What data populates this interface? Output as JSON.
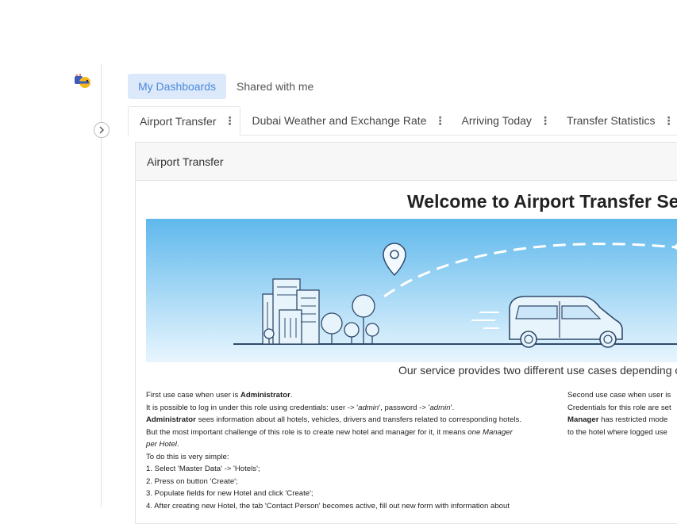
{
  "top_tabs": [
    {
      "label": "My Dashboards",
      "active": true
    },
    {
      "label": "Shared with me",
      "active": false
    }
  ],
  "dashboard_tabs": [
    {
      "label": "Airport Transfer",
      "active": true
    },
    {
      "label": "Dubai Weather and Exchange Rate",
      "active": false
    },
    {
      "label": "Arriving Today",
      "active": false
    },
    {
      "label": "Transfer Statistics",
      "active": false
    }
  ],
  "tab_menu_glyph": "⋮",
  "panel": {
    "title": "Airport Transfer",
    "welcome": "Welcome to Airport Transfer Ser",
    "subtitle": "Our service provides two different use cases depending on",
    "col1": {
      "l1_pre": "First use case when user is ",
      "l1_bold": "Administrator",
      "l1_post": ".",
      "l2_pre": "It is possible to log in under this role using credentials: user -> '",
      "l2_user": "admin",
      "l2_mid": "', password -> '",
      "l2_pass": "admin",
      "l2_post": "'.",
      "l3_bold": "Administrator",
      "l3_post": " sees information about all hotels, vehicles, drivers and transfers related to corresponding hotels.",
      "l4_pre": "But the most important challenge of this role is to create new hotel and manager for it, it means ",
      "l4_italic": "one Manager",
      "l5_italic": "per Hotel",
      "l5_post": ".",
      "l6": "To do this is very simple:",
      "l7": "1. Select 'Master Data' -> 'Hotels';",
      "l8": "2. Press on button 'Create';",
      "l9": "3. Populate fields for new Hotel and click 'Create';",
      "l10": "4. After creating new Hotel, the tab 'Contact Person' becomes active, fill out new form with information about"
    },
    "col2": {
      "l1": "Second use case when user is ",
      "l2": "Credentials for this role are set",
      "l3_bold": "Manager",
      "l3_post": " has restricted mode",
      "l4": "to the hotel where logged use"
    }
  },
  "colors": {
    "accent": "#4a8ad8",
    "active_tab_bg": "#dce9fb",
    "banner_sky": "#5fb8ec",
    "illustration_line": "#2f4a6b"
  }
}
